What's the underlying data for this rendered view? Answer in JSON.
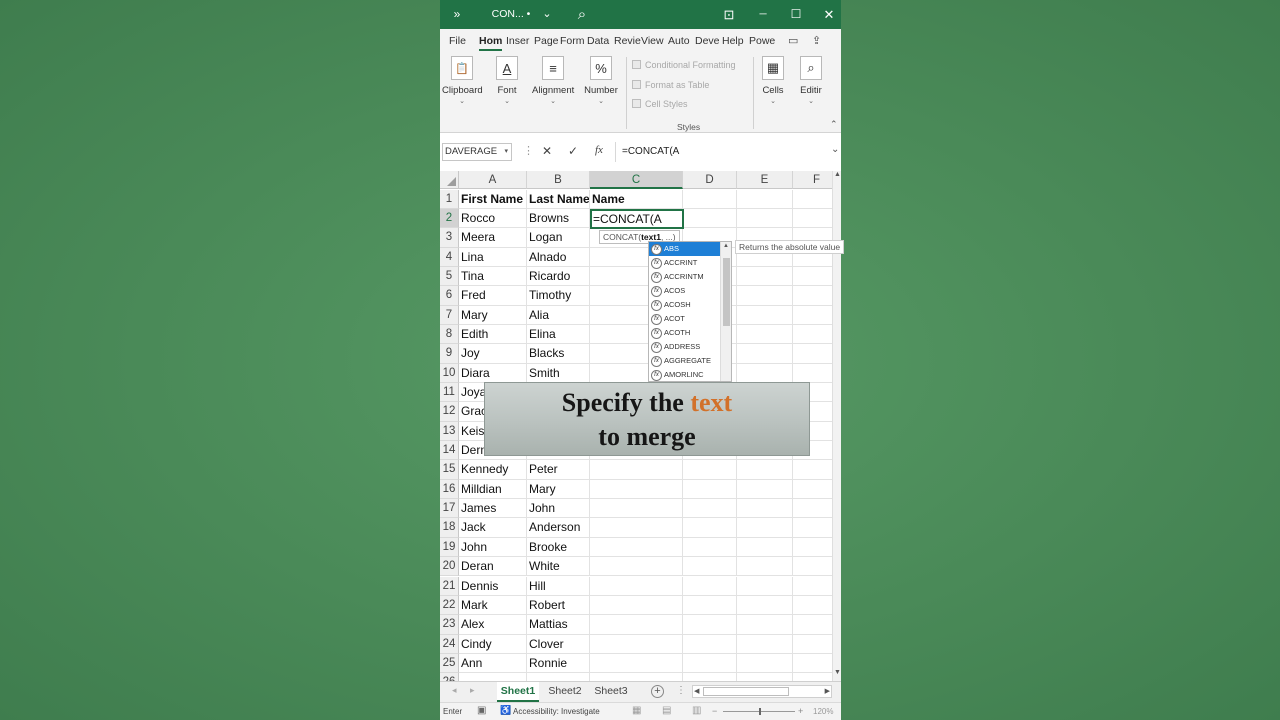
{
  "window": {
    "title": "CON... • Sa...",
    "expand_glyph": "»",
    "dropdown_glyph": "⌄",
    "search_glyph": "⌕",
    "present_glyph": "⊡",
    "minimize_glyph": "─",
    "maximize_glyph": "☐",
    "close_glyph": "✕"
  },
  "ribbon_tabs": [
    {
      "label": "File"
    },
    {
      "label": "Hom"
    },
    {
      "label": "Inser"
    },
    {
      "label": "Page"
    },
    {
      "label": "Form"
    },
    {
      "label": "Data"
    },
    {
      "label": "Revie"
    },
    {
      "label": "View"
    },
    {
      "label": "Auto"
    },
    {
      "label": "Deve"
    },
    {
      "label": "Help"
    },
    {
      "label": "Powe"
    }
  ],
  "ribbon_right": {
    "comment_glyph": "▭",
    "share_glyph": "⇪"
  },
  "ribbon": {
    "clipboard": {
      "label": "Clipboard",
      "glyph": "📋"
    },
    "font": {
      "label": "Font",
      "glyph": "A"
    },
    "alignment": {
      "label": "Alignment",
      "glyph": "≡"
    },
    "number": {
      "label": "Number",
      "glyph": "%"
    },
    "styles": {
      "conditional": "Conditional Formatting",
      "format_table": "Format as Table",
      "cell_styles": "Cell Styles",
      "label": "Styles"
    },
    "cells": {
      "label": "Cells",
      "glyph": "▦"
    },
    "editing": {
      "label": "Editir",
      "glyph": "⌕"
    },
    "chevron": "⌄",
    "collapse_glyph": "⌃"
  },
  "formula_bar": {
    "name_box": "DAVERAGE",
    "name_dropdown": "▾",
    "cancel_glyph": "✕",
    "enter_glyph": "✓",
    "fx_label": "fx",
    "formula": "=CONCAT(A",
    "expand_glyph": "⌄"
  },
  "grid": {
    "columns": [
      "A",
      "B",
      "C",
      "D",
      "E",
      "F"
    ],
    "rows": [
      {
        "num": "1",
        "a": "First Name",
        "b": "Last Name",
        "c": "Name"
      },
      {
        "num": "2",
        "a": "Rocco",
        "b": "Browns",
        "c": ""
      },
      {
        "num": "3",
        "a": "Meera",
        "b": "Logan",
        "c": ""
      },
      {
        "num": "4",
        "a": "Lina",
        "b": "Alnado",
        "c": ""
      },
      {
        "num": "5",
        "a": "Tina",
        "b": "Ricardo",
        "c": ""
      },
      {
        "num": "6",
        "a": "Fred",
        "b": "Timothy",
        "c": ""
      },
      {
        "num": "7",
        "a": "Mary",
        "b": "Alia",
        "c": ""
      },
      {
        "num": "8",
        "a": "Edith",
        "b": "Elina",
        "c": ""
      },
      {
        "num": "9",
        "a": "Joy",
        "b": "Blacks",
        "c": ""
      },
      {
        "num": "10",
        "a": "Diara",
        "b": "Smith",
        "c": ""
      },
      {
        "num": "11",
        "a": "Joya",
        "b": "",
        "c": ""
      },
      {
        "num": "12",
        "a": "Grac",
        "b": "",
        "c": ""
      },
      {
        "num": "13",
        "a": "Keisl",
        "b": "",
        "c": ""
      },
      {
        "num": "14",
        "a": "Dern",
        "b": "",
        "c": ""
      },
      {
        "num": "15",
        "a": "Kennedy",
        "b": "Peter",
        "c": ""
      },
      {
        "num": "16",
        "a": "Milldian",
        "b": "Mary",
        "c": ""
      },
      {
        "num": "17",
        "a": "James",
        "b": "John",
        "c": ""
      },
      {
        "num": "18",
        "a": "Jack",
        "b": "Anderson",
        "c": ""
      },
      {
        "num": "19",
        "a": "John",
        "b": "Brooke",
        "c": ""
      },
      {
        "num": "20",
        "a": "Deran",
        "b": "White",
        "c": ""
      },
      {
        "num": "21",
        "a": "Dennis",
        "b": "Hill",
        "c": ""
      },
      {
        "num": "22",
        "a": "Mark",
        "b": "Robert",
        "c": ""
      },
      {
        "num": "23",
        "a": "Alex",
        "b": "Mattias",
        "c": ""
      },
      {
        "num": "24",
        "a": "Cindy",
        "b": "Clover",
        "c": ""
      },
      {
        "num": "25",
        "a": "Ann",
        "b": "Ronnie",
        "c": ""
      },
      {
        "num": "26",
        "a": "",
        "b": "",
        "c": ""
      }
    ],
    "active_cell_text": "=CONCAT(A"
  },
  "autocomplete": {
    "tooltip_fn": "CONCAT(",
    "tooltip_arg": "text1",
    "tooltip_rest": ", ...)",
    "icon_label": "fx",
    "items": [
      {
        "label": "ABS"
      },
      {
        "label": "ACCRINT"
      },
      {
        "label": "ACCRINTM"
      },
      {
        "label": "ACOS"
      },
      {
        "label": "ACOSH"
      },
      {
        "label": "ACOT"
      },
      {
        "label": "ACOTH"
      },
      {
        "label": "ADDRESS"
      },
      {
        "label": "AGGREGATE"
      },
      {
        "label": "AMORLINC"
      }
    ],
    "description": "Returns the absolute value",
    "scroll_up": "▲"
  },
  "caption": {
    "pre": "Specify the",
    "highlight": "text",
    "line2": "to merge",
    "highlight_color": "#d2712a"
  },
  "scroll": {
    "up": "▲",
    "down": "▼",
    "left": "◀",
    "right": "▶"
  },
  "sheets": {
    "nav_prev": "◂",
    "nav_next": "▸",
    "tabs": [
      {
        "label": "Sheet1"
      },
      {
        "label": "Sheet2"
      },
      {
        "label": "Sheet3"
      }
    ],
    "add_glyph": "+",
    "more_glyph": "⋮"
  },
  "status": {
    "mode": "Enter",
    "macro_glyph": "▣",
    "accessibility_glyph": "♿",
    "accessibility": "Accessibility: Investigate",
    "normal_glyph": "▦",
    "layout_glyph": "▤",
    "pagebreak_glyph": "▥",
    "zoom_out": "−",
    "zoom_in": "+",
    "zoom": "120%"
  },
  "colors": {
    "excel_green": "#217346",
    "background_green": "#4a8a58",
    "selection_blue": "#1e7fd6"
  }
}
